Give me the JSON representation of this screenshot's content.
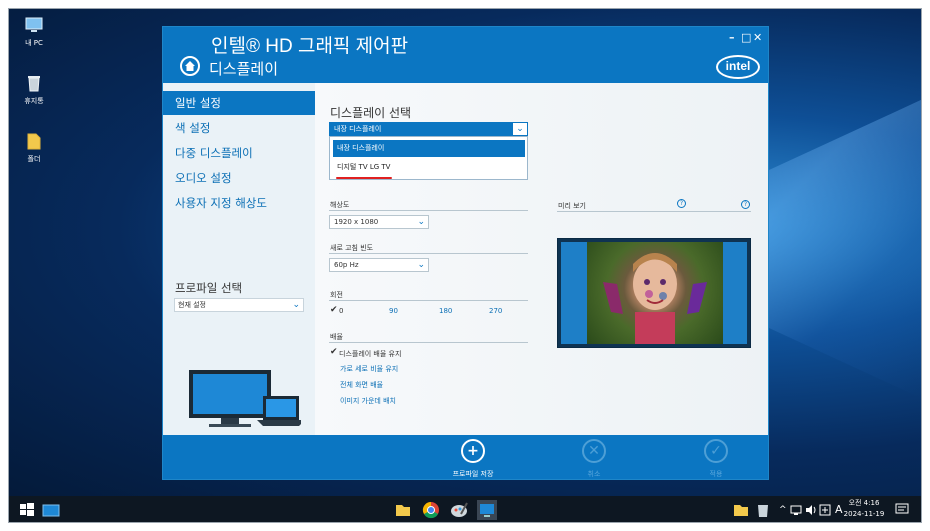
{
  "desktop": {
    "icons": [
      {
        "label": "내 PC",
        "icon": "computer-icon"
      },
      {
        "label": "휴지통",
        "icon": "recycle-bin-icon"
      },
      {
        "label": "폴더",
        "icon": "folder-icon"
      }
    ]
  },
  "window": {
    "title": "인텔® HD 그래픽 제어판",
    "subtitle": "디스플레이",
    "controls": {
      "minimize": "–",
      "restore": "□",
      "close": "✕"
    },
    "brand": "intel"
  },
  "sidebar": {
    "items": [
      {
        "label": "일반 설정",
        "active": true
      },
      {
        "label": "색 설정",
        "active": false
      },
      {
        "label": "다중 디스플레이",
        "active": false
      },
      {
        "label": "오디오 설정",
        "active": false
      },
      {
        "label": "사용자 지정 해상도",
        "active": false
      }
    ],
    "profile_label": "프로파일 선택",
    "profile_value": "현재 설정"
  },
  "main": {
    "display_select_label": "디스플레이 선택",
    "display_selected": "내장 디스플레이",
    "display_options": [
      {
        "label": "내장 디스플레이",
        "selected": true
      },
      {
        "label": "디지털 TV LG TV",
        "selected": false
      }
    ],
    "resolution": {
      "label": "해상도",
      "value": "1920 x 1080"
    },
    "refresh": {
      "label": "새로 고침 빈도",
      "value": "60p Hz"
    },
    "rotation": {
      "label": "회전",
      "options": [
        "0",
        "90",
        "180",
        "270"
      ],
      "checked": "0"
    },
    "scaling": {
      "label": "배율",
      "checked": "디스플레이 배율 유지",
      "options": [
        "가로 세로 비율 유지",
        "전체 화면 배율",
        "이미지 가운데 배치"
      ]
    },
    "preview_label": "미리 보기",
    "help": "?"
  },
  "bottom": {
    "save": "프로파일 저장",
    "cancel": "취소",
    "apply": "적용"
  },
  "taskbar": {
    "clock_period": "오전 4:16",
    "clock_date": "2024-11-19",
    "ime": "A"
  },
  "colors": {
    "accent": "#0b76c2",
    "underline": "#e02020"
  }
}
